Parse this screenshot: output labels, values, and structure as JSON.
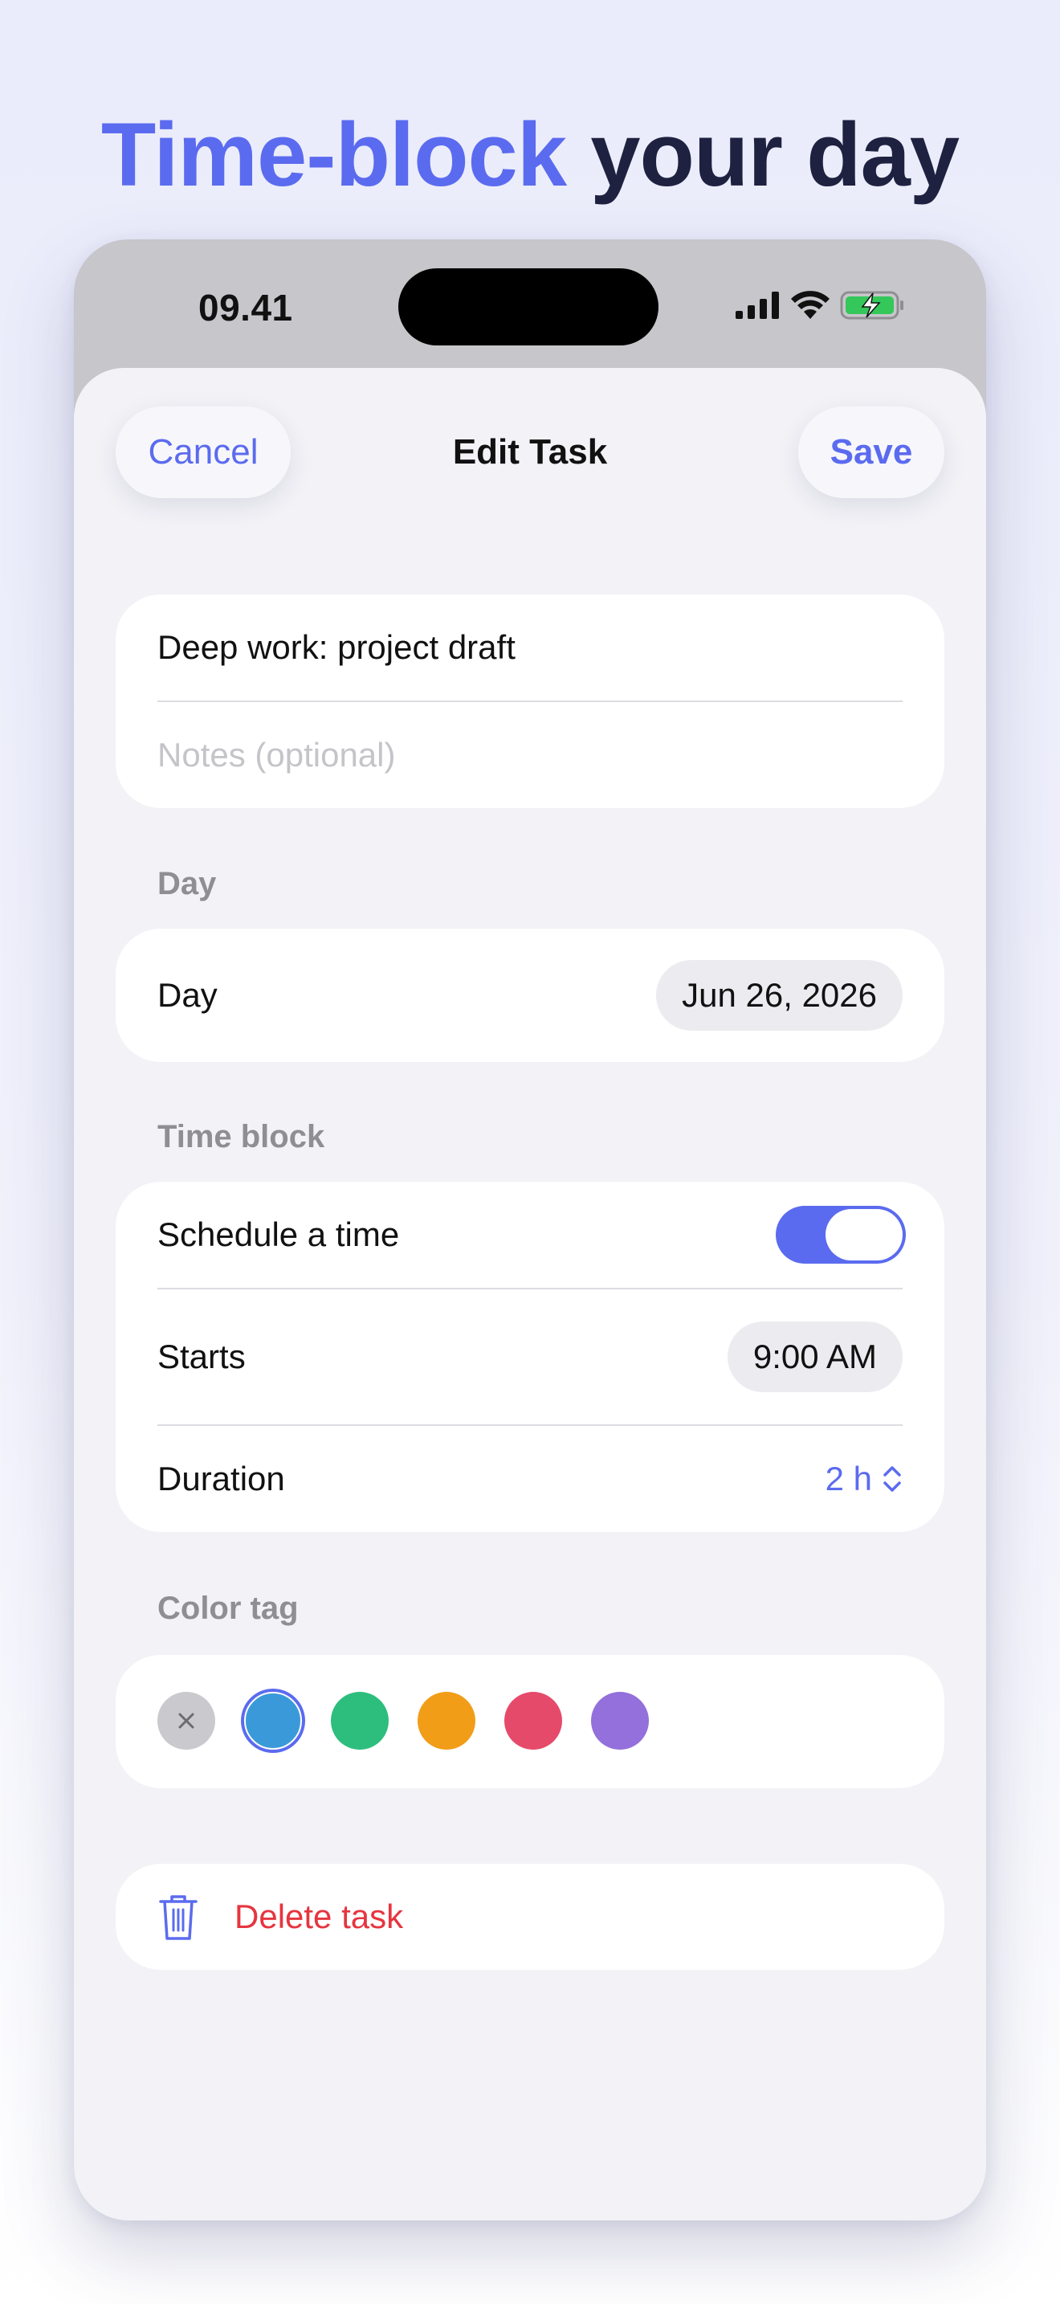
{
  "headline": {
    "accent": "Time-block",
    "rest": " your day"
  },
  "status_bar": {
    "time": "09.41"
  },
  "nav": {
    "cancel": "Cancel",
    "title": "Edit Task",
    "save": "Save"
  },
  "task": {
    "title": "Deep work: project draft",
    "notes_placeholder": "Notes (optional)"
  },
  "day_section": {
    "label": "Day",
    "row_label": "Day",
    "value": "Jun 26, 2026"
  },
  "time_section": {
    "label": "Time block",
    "schedule_label": "Schedule a time",
    "schedule_enabled": true,
    "starts_label": "Starts",
    "starts_value": "9:00 AM",
    "duration_label": "Duration",
    "duration_value": "2 h"
  },
  "color_section": {
    "label": "Color tag",
    "swatches": [
      {
        "name": "none",
        "color": "#c9c9ce"
      },
      {
        "name": "blue",
        "color": "#3a9ad9",
        "selected": true
      },
      {
        "name": "green",
        "color": "#2dbe7e"
      },
      {
        "name": "orange",
        "color": "#f29d17"
      },
      {
        "name": "red",
        "color": "#e64a6b"
      },
      {
        "name": "purple",
        "color": "#9370db"
      }
    ]
  },
  "delete": {
    "label": "Delete task",
    "icon": "trash-icon"
  },
  "colors": {
    "accent": "#5b6bef",
    "destructive": "#e6353f",
    "headline_dark": "#1e2140"
  }
}
